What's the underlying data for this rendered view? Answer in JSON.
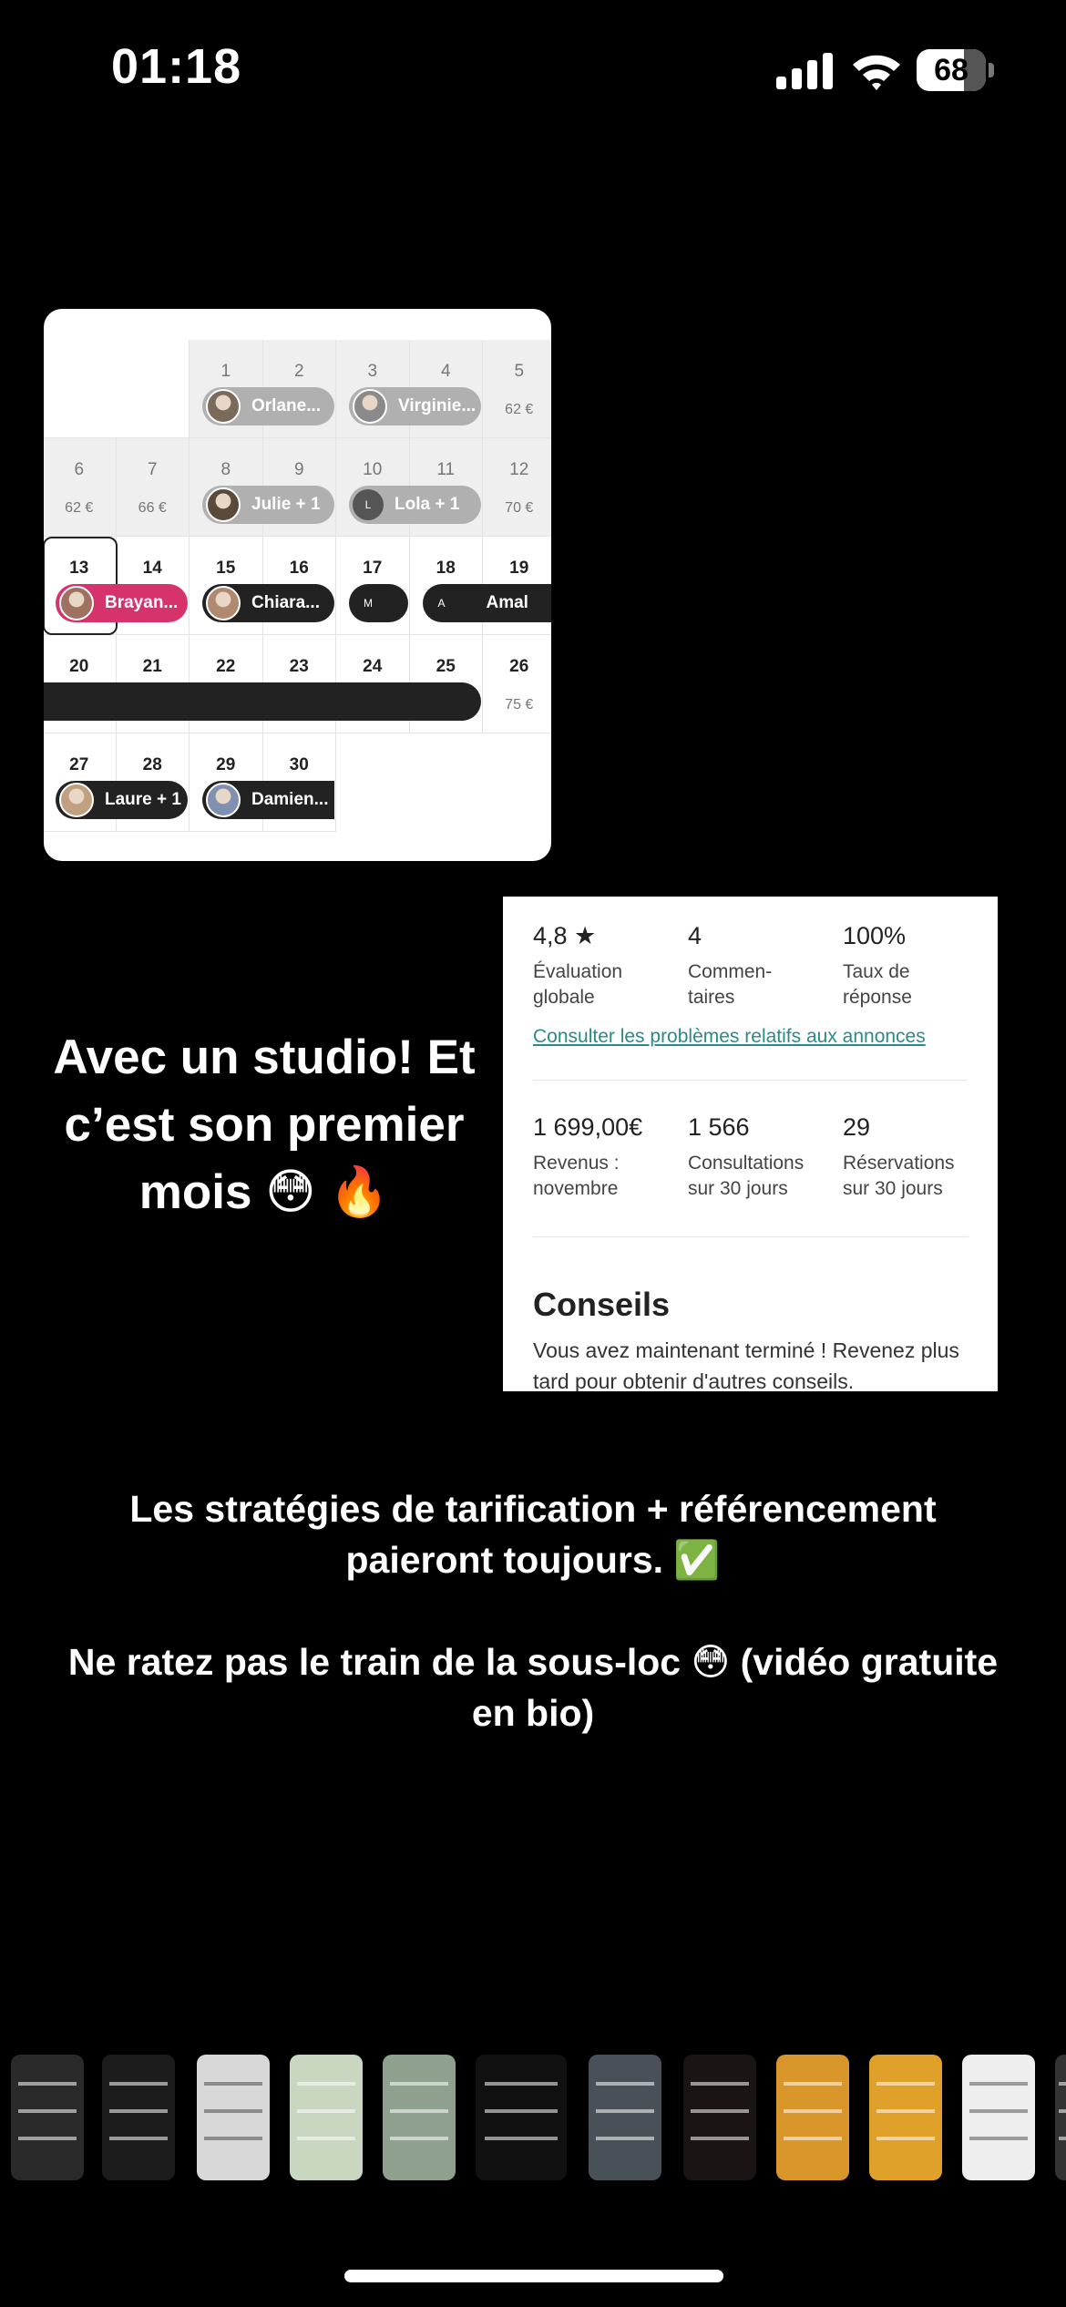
{
  "status_bar": {
    "time": "01:18",
    "battery": "68",
    "battery_fraction": 0.68
  },
  "calendar": {
    "days": [
      {
        "n": "1",
        "price": ""
      },
      {
        "n": "2",
        "price": ""
      },
      {
        "n": "3",
        "price": ""
      },
      {
        "n": "4",
        "price": ""
      },
      {
        "n": "5",
        "price": "62 €"
      },
      {
        "n": "6",
        "price": "62 €"
      },
      {
        "n": "7",
        "price": "66 €"
      },
      {
        "n": "8",
        "price": ""
      },
      {
        "n": "9",
        "price": ""
      },
      {
        "n": "10",
        "price": ""
      },
      {
        "n": "11",
        "price": ""
      },
      {
        "n": "12",
        "price": "70 €"
      },
      {
        "n": "13",
        "price": ""
      },
      {
        "n": "14",
        "price": ""
      },
      {
        "n": "15",
        "price": ""
      },
      {
        "n": "16",
        "price": ""
      },
      {
        "n": "17",
        "price": ""
      },
      {
        "n": "18",
        "price": ""
      },
      {
        "n": "19",
        "price": ""
      },
      {
        "n": "20",
        "price": ""
      },
      {
        "n": "21",
        "price": ""
      },
      {
        "n": "22",
        "price": ""
      },
      {
        "n": "23",
        "price": ""
      },
      {
        "n": "24",
        "price": ""
      },
      {
        "n": "25",
        "price": ""
      },
      {
        "n": "26",
        "price": "75 €"
      },
      {
        "n": "27",
        "price": ""
      },
      {
        "n": "28",
        "price": ""
      },
      {
        "n": "29",
        "price": ""
      },
      {
        "n": "30",
        "price": ""
      }
    ],
    "bookings": [
      {
        "label": "Orlane..."
      },
      {
        "label": "Virginie..."
      },
      {
        "label": "Julie + 1"
      },
      {
        "label": "Lola + 1",
        "initial": "L"
      },
      {
        "label": "Brayan..."
      },
      {
        "label": "Chiara..."
      },
      {
        "label": "",
        "initial": "M"
      },
      {
        "label": "Amal",
        "initial": "A"
      },
      {
        "label": ""
      },
      {
        "label": "Laure + 1"
      },
      {
        "label": "Damien..."
      }
    ],
    "colors": {
      "booking_past": "#b0b0b0",
      "booking_current": "#222222",
      "booking_highlight": "#d6336c"
    }
  },
  "stats": {
    "rating": {
      "value": "4,8 ★",
      "label": "Évaluation globale"
    },
    "comments": {
      "value": "4",
      "label": "Commen-\ntaires"
    },
    "response": {
      "value": "100%",
      "label": "Taux de réponse"
    },
    "link": "Consulter les problèmes relatifs aux annonces",
    "revenue": {
      "value": "1 699,00€",
      "label": "Revenus : novembre"
    },
    "views": {
      "value": "1 566",
      "label": "Consultations sur 30 jours"
    },
    "bookings": {
      "value": "29",
      "label": "Réservations sur 30 jours"
    },
    "tips_title": "Conseils",
    "tips_text": "Vous avez maintenant terminé ! Revenez plus tard pour obtenir d'autres conseils."
  },
  "caption_left": "Avec un studio! Et c’est son premier mois 😳 🔥",
  "caption_bottom": {
    "line1": "Les stratégies de tarification + référencement paieront toujours. ✅",
    "line2": "Ne ratez pas le train de la sous-loc 😳 (vidéo gratuite en bio)"
  }
}
